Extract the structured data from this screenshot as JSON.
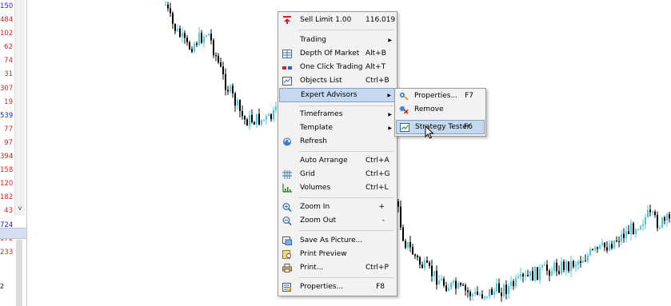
{
  "left_panel": {
    "values": [
      {
        "text": "150",
        "color": "#1a1ae6"
      },
      {
        "text": "484",
        "color": "#e02020"
      },
      {
        "text": "102",
        "color": "#e02020"
      },
      {
        "text": "62",
        "color": "#e02020"
      },
      {
        "text": "74",
        "color": "#e02020"
      },
      {
        "text": "31",
        "color": "#e02020"
      },
      {
        "text": "307",
        "color": "#e02020"
      },
      {
        "text": "19",
        "color": "#e02020"
      },
      {
        "text": "539",
        "color": "#1a1ae6"
      },
      {
        "text": "77",
        "color": "#e02020"
      },
      {
        "text": "97",
        "color": "#e02020"
      },
      {
        "text": "394",
        "color": "#e02020"
      },
      {
        "text": "158",
        "color": "#e02020"
      },
      {
        "text": "120",
        "color": "#e02020"
      },
      {
        "text": "182",
        "color": "#e02020"
      },
      {
        "text": "43",
        "color": "#e02020"
      },
      {
        "text": "724",
        "color": "#1a1ae6"
      },
      {
        "text": "172",
        "color": "#e02020"
      },
      {
        "text": "233",
        "color": "#e02020"
      }
    ],
    "scroll_down_glyph": "v",
    "lower_value": "2"
  },
  "context_menu": {
    "items": [
      {
        "label": "Sell Limit 1.00",
        "shortcut": "116.019",
        "icon": "sell-limit-icon"
      },
      {
        "label": "Trading",
        "submenu": true
      },
      {
        "label": "Depth Of Market",
        "shortcut": "Alt+B",
        "icon": "depth-of-market-icon"
      },
      {
        "label": "One Click Trading",
        "shortcut": "Alt+T",
        "icon": "one-click-trading-icon"
      },
      {
        "label": "Objects List",
        "shortcut": "Ctrl+B",
        "icon": "objects-list-icon"
      },
      {
        "label": "Expert Advisors",
        "submenu": true,
        "highlighted": true
      },
      {
        "label": "Timeframes",
        "submenu": true
      },
      {
        "label": "Template",
        "submenu": true
      },
      {
        "label": "Refresh",
        "icon": "refresh-icon"
      },
      {
        "label": "Auto Arrange",
        "shortcut": "Ctrl+A"
      },
      {
        "label": "Grid",
        "shortcut": "Ctrl+G",
        "icon": "grid-icon"
      },
      {
        "label": "Volumes",
        "shortcut": "Ctrl+L",
        "icon": "volumes-icon"
      },
      {
        "label": "Zoom In",
        "shortcut": "+",
        "icon": "zoom-in-icon"
      },
      {
        "label": "Zoom Out",
        "shortcut": "-",
        "icon": "zoom-out-icon"
      },
      {
        "label": "Save As Picture...",
        "icon": "save-picture-icon"
      },
      {
        "label": "Print Preview",
        "icon": "print-preview-icon"
      },
      {
        "label": "Print...",
        "shortcut": "Ctrl+P",
        "icon": "print-icon"
      },
      {
        "label": "Properties...",
        "shortcut": "F8",
        "icon": "properties-icon"
      }
    ]
  },
  "submenu": {
    "items": [
      {
        "label": "Properties...",
        "shortcut": "F7",
        "icon": "ea-properties-icon"
      },
      {
        "label": "Remove",
        "icon": "ea-remove-icon"
      },
      {
        "label": "Strategy Tester",
        "shortcut": "F6",
        "icon": "strategy-tester-icon",
        "highlighted": true
      }
    ]
  },
  "colors": {
    "bull_candle": "#4ec7e0",
    "bear_candle": "#000000",
    "menu_highlight": "#c5d8f0",
    "menu_highlight_border": "#7da2ce"
  }
}
